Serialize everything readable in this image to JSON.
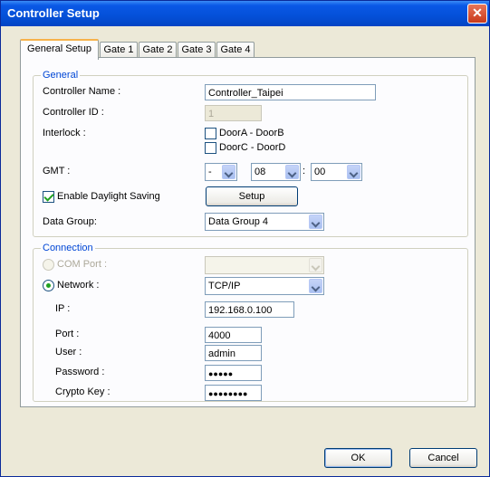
{
  "window": {
    "title": "Controller Setup",
    "close_glyph": "✕"
  },
  "tabs": [
    "General Setup",
    "Gate 1",
    "Gate 2",
    "Gate 3",
    "Gate 4"
  ],
  "general": {
    "legend": "General",
    "controller_name_label": "Controller Name :",
    "controller_name_value": "Controller_Taipei",
    "controller_id_label": "Controller ID :",
    "controller_id_value": "1",
    "interlock_label": "Interlock :",
    "interlock_a_label": "DoorA - DoorB",
    "interlock_c_label": "DoorC - DoorD",
    "gmt_label": "GMT :",
    "gmt_sign": "-",
    "gmt_hour": "08",
    "gmt_sep": ":",
    "gmt_minute": "00",
    "dst_label": "Enable Daylight Saving",
    "dst_checked": true,
    "setup_button": "Setup",
    "data_group_label": "Data Group:",
    "data_group_value": "Data Group 4"
  },
  "connection": {
    "legend": "Connection",
    "com_port_label": "COM Port :",
    "network_label": "Network :",
    "network_value": "TCP/IP",
    "ip_label": "IP :",
    "ip_value": "192.168.0.100",
    "port_label": "Port :",
    "port_value": "4000",
    "user_label": "User :",
    "user_value": "admin",
    "password_label": "Password :",
    "password_value": "●●●●●",
    "crypto_label": "Crypto Key :",
    "crypto_value": "●●●●●●●●"
  },
  "footer": {
    "ok": "OK",
    "cancel": "Cancel"
  }
}
